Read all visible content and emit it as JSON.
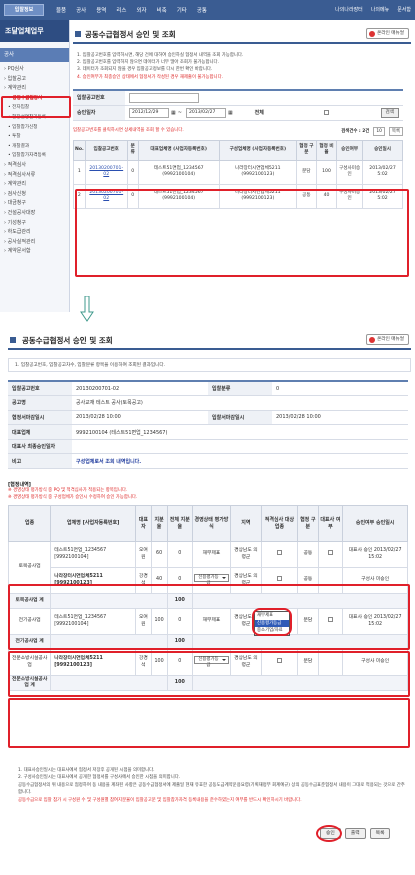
{
  "top": {
    "logo": "입찰정보",
    "nav": [
      "물품",
      "공사",
      "용역",
      "리스",
      "외자",
      "비축",
      "기타",
      "공통"
    ],
    "util": [
      "나의나라장터",
      "나의메뉴",
      "문서함"
    ]
  },
  "sidebar": {
    "title": "조달업체업무",
    "section": "공사",
    "items": [
      {
        "label": "PQ심사",
        "sub": false,
        "active": false
      },
      {
        "label": "입찰공고",
        "sub": false,
        "active": false
      },
      {
        "label": "계약관리",
        "sub": false,
        "active": false
      },
      {
        "label": "공동수급협정서",
        "sub": true,
        "active": true
      },
      {
        "label": "전자입찰",
        "sub": true,
        "active": false
      },
      {
        "label": "현장설명참가등록",
        "sub": true,
        "active": false
      },
      {
        "label": "입찰참가신청",
        "sub": true,
        "active": false
      },
      {
        "label": "투찰",
        "sub": true,
        "active": false
      },
      {
        "label": "개찰결과",
        "sub": true,
        "active": false
      },
      {
        "label": "입찰참가자격등록",
        "sub": true,
        "active": false
      },
      {
        "label": "적격심사",
        "sub": false,
        "active": false
      },
      {
        "label": "적격심사서류",
        "sub": false,
        "active": false
      },
      {
        "label": "계약관리",
        "sub": false,
        "active": false
      },
      {
        "label": "검사신청",
        "sub": false,
        "active": false
      },
      {
        "label": "대금청구",
        "sub": false,
        "active": false
      },
      {
        "label": "건설공사대장",
        "sub": false,
        "active": false
      },
      {
        "label": "기성청구",
        "sub": false,
        "active": false
      },
      {
        "label": "하도급관리",
        "sub": false,
        "active": false
      },
      {
        "label": "공사실적관리",
        "sub": false,
        "active": false
      },
      {
        "label": "계약문서함",
        "sub": false,
        "active": false
      }
    ]
  },
  "page1": {
    "title": "공동수급협정서 승인 및 조회",
    "help": "온라인 매뉴얼",
    "notes": [
      {
        "text": "1. 입찰공고번호를 입력하시면, 해당 건에 대하여 승인하실 협정서 내역을 조회 가능합니다.",
        "red": false
      },
      {
        "text": "2. 입찰공고번호를 입력하지 않으면 데이터가 너무 많아 조회가 불가능합니다.",
        "red": false
      },
      {
        "text": "3. 데이터가 조회되지 않을 경우 입찰공고정보를 다시 한번 확인 바랍니다.",
        "red": false
      },
      {
        "text": "4. 승인여부가 최종승인 상태에서 협정서가 작성된 경우 재제출이 불가능합니다.",
        "red": true
      }
    ],
    "search": {
      "no_label": "입찰공고번호",
      "no_value": "",
      "date_label": "승인일자",
      "date_from": "2012/12/29",
      "date_to": "2013/02/27",
      "all_label": "전체",
      "btn": "검색"
    },
    "hint": "입찰공고번호를 클릭하시면 상세내역을 조회 할 수 있습니다.",
    "pager": {
      "total": "검색건수 : 2건",
      "size": "10",
      "btn": "목록"
    },
    "columns": [
      "No.",
      "입찰공고번호",
      "분류",
      "대표업체명 (사업자등록번호)",
      "구성업체명 (사업자등록번호)",
      "협정 구분",
      "협정 비율",
      "승인여부",
      "승인일시"
    ],
    "rows": [
      [
        "1",
        "20130200701-02",
        "0",
        "테스트51면업_1234567 (9992100104)",
        "나라장터시연업체5211 (9992100123)",
        "분담",
        "100",
        "구성사미승인",
        "2013/02/27 5:02"
      ],
      [
        "2",
        "20130200701-02",
        "0",
        "테스트51면업_1234567 (9992100104)",
        "나라장터시연업체5211 (9992100123)",
        "공동",
        "40",
        "구성사미승인",
        "2013/02/27 5:02"
      ]
    ]
  },
  "page2": {
    "title": "공동수급협정서 승인 및 조회",
    "help": "온라인 매뉴얼",
    "info": "1. 입찰공고번호, 입찰공고차수, 입찰분류 항목을 이용하여 조회된 결과입니다.",
    "details": [
      {
        "k": "입찰공고번호",
        "v": "20130200701-02",
        "k2": "입찰분류",
        "v2": "0"
      },
      {
        "k": "공고명",
        "v": "공사교재 테스트 공사(토목공고)",
        "k2": "",
        "v2": ""
      },
      {
        "k": "협정서마감일시",
        "v": "2013/02/28 10:00",
        "k2": "입찰서마감일시",
        "v2": "2013/02/28 10:00"
      },
      {
        "k": "대표업체",
        "v": "9992100104 (테스트51면업_1234567)",
        "k2": "",
        "v2": ""
      },
      {
        "k": "대표사 최종승인일자",
        "v": "",
        "k2": "",
        "v2": ""
      },
      {
        "k": "비고",
        "v": "구성업체로서 조회 내역입니다.",
        "k2": "",
        "v2": ""
      }
    ],
    "sec_title": "[협정내역]",
    "sec_notes": [
      "※ 경영상태 평가방식 중 PQ 및 적격심사가 적용되는 항목입니다.",
      "※ 경영상태 평가방식 중 구성업체가 승인시 수정하여 승인 가능합니다."
    ],
    "columns": [
      "업종",
      "업체명 [사업자등록번호]",
      "대표자",
      "지분율",
      "전체 지분율",
      "경영상태 평가방식",
      "지역",
      "적격심사 대상업종",
      "협정 구분",
      "대표사 여부",
      "승인여부 승인일시"
    ],
    "groups": [
      {
        "industry": "토목공사업",
        "rows": [
          {
            "company": "테스트51면업_1234567 [9992100104]",
            "ceo": "오여원",
            "share": "60",
            "total": "0",
            "eval": "재무제표",
            "region": "경상남도 의령군",
            "type": "공동",
            "rep": "Y",
            "status": "대표사 승인 2013/02/27 15:02"
          },
          {
            "company": "나라장터시연업체5211 [9992100123]",
            "ceo": "강경석",
            "share": "40",
            "total": "0",
            "eval": "신용평가등급",
            "region": "경상남도 의령군",
            "type": "공동",
            "rep": "N",
            "status": "구성사 미승인"
          }
        ],
        "subtotal_label": "토목공사업 계",
        "subtotal": "100"
      },
      {
        "industry": "전기공사업",
        "rows": [
          {
            "company": "테스트51면업_1234567 [9992100104]",
            "ceo": "오여원",
            "share": "100",
            "total": "0",
            "eval": "재무제표",
            "region": "경상남도 의령군",
            "type": "분담",
            "rep": "Y",
            "status": "대표사 승인 2013/02/27 15:02"
          }
        ],
        "subtotal_label": "전기공사업 계",
        "subtotal": "100"
      },
      {
        "industry": "전문소방시설공사업",
        "rows": [
          {
            "company": "나라장터시연업체5211 [9992100123]",
            "ceo": "강경석",
            "share": "100",
            "total": "0",
            "eval": "신용평가등급",
            "region": "경상남도 의령군",
            "type": "분담",
            "rep": "N",
            "status": "구성사 미승인"
          }
        ],
        "subtotal_label": "전문소방시설공사업 계",
        "subtotal": "100"
      }
    ],
    "dropdown": [
      "재무제표",
      "신용평가등급",
      "중소기업/자료"
    ],
    "footnotes": [
      {
        "text": "1. 대표사승인일시는 대표사에서 협정서 저장후 공개된 시점을 의미합니다.",
        "red": false
      },
      {
        "text": "2. 구성사승인일시는 대표사에서 공개한 협정서를 구성사에서 승인한 시점을 의미합니다.",
        "red": false
      },
      {
        "text": "공동수급협정서의 위 내용으로 협정하며 동 내용을 계좌된 사항은 공동수급협정서에 제출일 현재 유효한 공동도급계약운용요령(기획재정부 회계예규) 상의 공동수급표준협정서 내용이 그대로 적용되는 것으로 간주합니다.",
        "red": false
      },
      {
        "text": "공동수급으로 입찰 참가 시 구성원 수 및 구성원별 참여지분율이 입찰공고문 및 입찰참가자격 등록내용을 준수하였는지 여부를 반드시 확인하시기 바랍니다.",
        "red": true
      }
    ],
    "buttons": [
      "승인",
      "출력",
      "목록"
    ]
  }
}
